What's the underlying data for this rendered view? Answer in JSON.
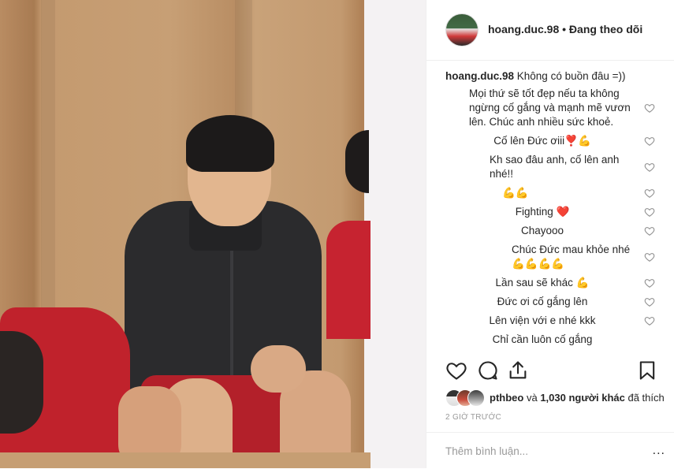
{
  "post": {
    "username": "hoang.duc.98",
    "separator": "•",
    "follow_status": "Đang theo dõi"
  },
  "caption": {
    "username": "hoang.duc.98",
    "text": "Không có buồn đâu =))"
  },
  "comments": [
    {
      "text": "Mọi thứ sẽ tốt đẹp nếu ta không ngừng cố gắng và mạnh mẽ vươn lên. Chúc anh nhiều sức khoẻ.",
      "align": "mixed"
    },
    {
      "text": "Cố lên Đức ơiii❣️💪",
      "align": "center"
    },
    {
      "text": "Kh sao đâu anh, cố lên anh nhé!!",
      "align": "mixed"
    },
    {
      "text": "💪💪",
      "align": "left"
    },
    {
      "text": "Fighting ❤️",
      "align": "center"
    },
    {
      "text": "Chayooo",
      "align": "center"
    },
    {
      "text": "Chúc Đức mau khỏe nhé 💪💪💪💪",
      "align": "mixed"
    },
    {
      "text": "Lần sau sẽ khác 💪",
      "align": "center"
    },
    {
      "text": "Đức ơi cố gắng lên",
      "align": "center"
    },
    {
      "text": "Lên viện với e nhé kkk",
      "align": "center"
    },
    {
      "text": "Chỉ cần luôn cố gắng",
      "align": "center"
    }
  ],
  "likes": {
    "user": "pthbeo",
    "connector": "và",
    "others": "1,030 người khác",
    "suffix": "đã thích"
  },
  "timestamp": "2 GIỜ TRƯỚC",
  "add_comment": {
    "placeholder": "Thêm bình luận...",
    "more": "..."
  },
  "colors": {
    "text": "#262626",
    "muted": "#999999",
    "border": "#efefef",
    "heart_outline": "#8e8e8e"
  },
  "icons": {
    "like": "heart-icon",
    "comment": "comment-icon",
    "share": "share-icon",
    "save": "bookmark-icon"
  }
}
